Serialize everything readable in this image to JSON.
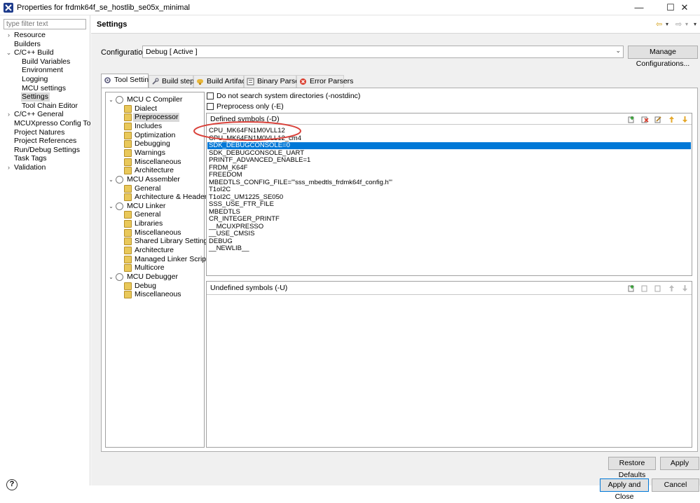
{
  "window": {
    "title": "Properties for frdmk64f_se_hostlib_se05x_minimal",
    "minimize": "—",
    "maximize": "☐",
    "close": "✕"
  },
  "nav": {
    "filter_placeholder": "type filter text",
    "items": [
      {
        "label": "Resource",
        "expandable": true
      },
      {
        "label": "Builders"
      },
      {
        "label": "C/C++ Build",
        "expanded": true
      },
      {
        "label": "Build Variables"
      },
      {
        "label": "Environment"
      },
      {
        "label": "Logging"
      },
      {
        "label": "MCU settings"
      },
      {
        "label": "Settings",
        "selected": true
      },
      {
        "label": "Tool Chain Editor"
      },
      {
        "label": "C/C++ General",
        "expandable": true
      },
      {
        "label": "MCUXpresso Config Tools"
      },
      {
        "label": "Project Natures"
      },
      {
        "label": "Project References"
      },
      {
        "label": "Run/Debug Settings"
      },
      {
        "label": "Task Tags"
      },
      {
        "label": "Validation",
        "expandable": true
      }
    ]
  },
  "header": {
    "title": "Settings"
  },
  "configuration": {
    "label": "Configuration:",
    "value": "Debug  [ Active ]",
    "manage_label": "Manage Configurations..."
  },
  "tabs": [
    {
      "label": "Tool Settings",
      "active": true,
      "icon": "gear-icon"
    },
    {
      "label": "Build steps",
      "icon": "wrench-icon"
    },
    {
      "label": "Build Artifact",
      "icon": "artifact-icon"
    },
    {
      "label": "Binary Parsers",
      "icon": "binary-icon"
    },
    {
      "label": "Error Parsers",
      "icon": "error-icon"
    }
  ],
  "tool_tree": [
    {
      "label": "MCU C Compiler",
      "level": 0,
      "icon": "gear-icon"
    },
    {
      "label": "Dialect",
      "level": 1
    },
    {
      "label": "Preprocessor",
      "level": 1,
      "selected": true
    },
    {
      "label": "Includes",
      "level": 1
    },
    {
      "label": "Optimization",
      "level": 1
    },
    {
      "label": "Debugging",
      "level": 1
    },
    {
      "label": "Warnings",
      "level": 1
    },
    {
      "label": "Miscellaneous",
      "level": 1
    },
    {
      "label": "Architecture",
      "level": 1
    },
    {
      "label": "MCU Assembler",
      "level": 0,
      "icon": "gear-icon"
    },
    {
      "label": "General",
      "level": 1
    },
    {
      "label": "Architecture & Headers",
      "level": 1
    },
    {
      "label": "MCU Linker",
      "level": 0,
      "icon": "gear-icon"
    },
    {
      "label": "General",
      "level": 1
    },
    {
      "label": "Libraries",
      "level": 1
    },
    {
      "label": "Miscellaneous",
      "level": 1
    },
    {
      "label": "Shared Library Settings",
      "level": 1
    },
    {
      "label": "Architecture",
      "level": 1
    },
    {
      "label": "Managed Linker Script",
      "level": 1
    },
    {
      "label": "Multicore",
      "level": 1
    },
    {
      "label": "MCU Debugger",
      "level": 0,
      "icon": "gear-icon"
    },
    {
      "label": "Debug",
      "level": 1
    },
    {
      "label": "Miscellaneous",
      "level": 1
    }
  ],
  "options": {
    "nostdinc_label": "Do not search system directories (-nostdinc)",
    "preprocess_only_label": "Preprocess only (-E)"
  },
  "defined_symbols": {
    "title": "Defined symbols (-D)",
    "items": [
      "CPU_MK64FN1M0VLL12",
      "CPU_MK64FN1M0VLL12_cm4",
      "SDK_DEBUGCONSOLE=0",
      "SDK_DEBUGCONSOLE_UART",
      "PRINTF_ADVANCED_ENABLE=1",
      "FRDM_K64F",
      "FREEDOM",
      "MBEDTLS_CONFIG_FILE='\"sss_mbedtls_frdmk64f_config.h\"'",
      "T1oI2C",
      "T1oI2C_UM1225_SE050",
      "SSS_USE_FTR_FILE",
      "MBEDTLS",
      "CR_INTEGER_PRINTF",
      "__MCUXPRESSO",
      "__USE_CMSIS",
      "DEBUG",
      "__NEWLIB__"
    ],
    "selected_index": 2
  },
  "undefined_symbols": {
    "title": "Undefined symbols (-U)",
    "items": []
  },
  "buttons": {
    "restore_defaults": "Restore Defaults",
    "apply": "Apply",
    "apply_close": "Apply and Close",
    "cancel": "Cancel",
    "help": "?"
  },
  "colors": {
    "selection": "#0078d7",
    "highlight_ellipse": "#d9413a"
  }
}
